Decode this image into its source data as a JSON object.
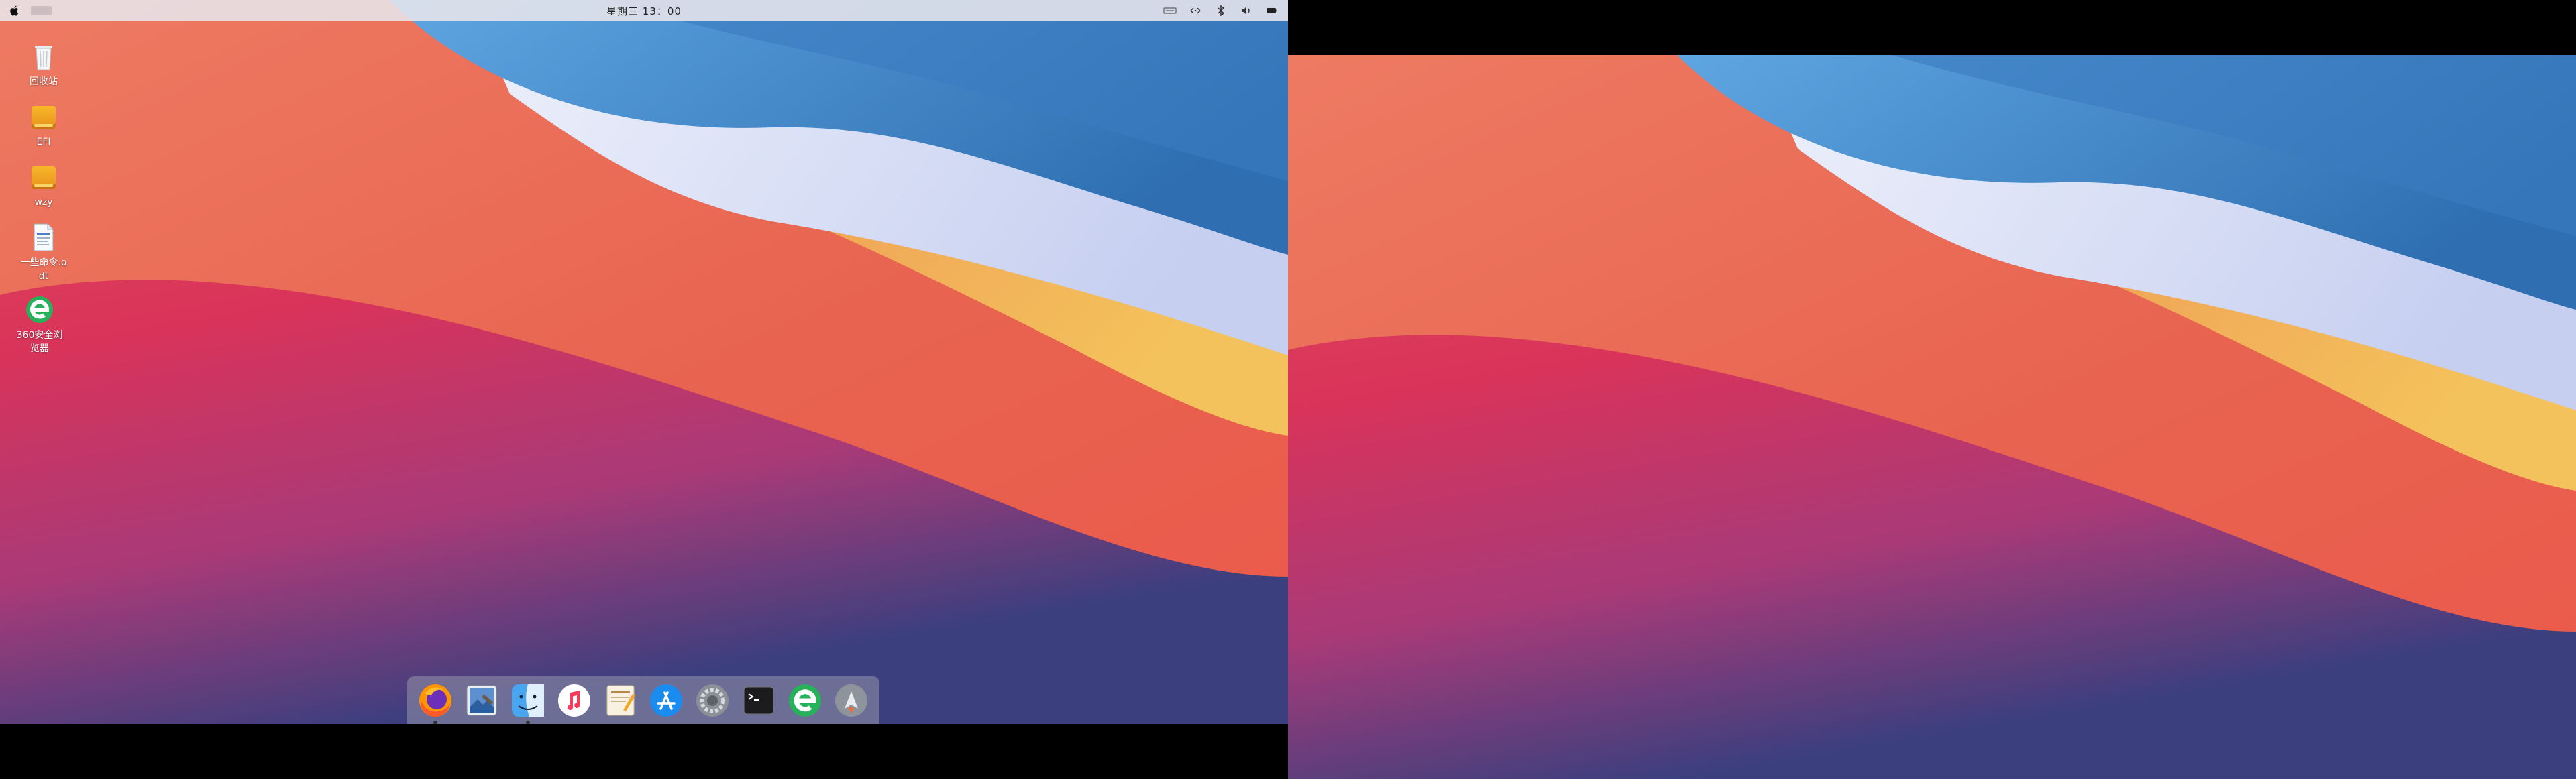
{
  "menubar": {
    "clock": "星期三 13：00",
    "tray_icons": [
      "input-method-icon",
      "network-icon",
      "bluetooth-icon",
      "volume-icon",
      "battery-icon"
    ]
  },
  "desktop": {
    "icons": [
      {
        "name": "trash",
        "label": "回收站",
        "icon": "trash-icon"
      },
      {
        "name": "efi",
        "label": "EFI",
        "icon": "drive-icon"
      },
      {
        "name": "wzy",
        "label": "wzy",
        "icon": "drive-icon"
      },
      {
        "name": "doc",
        "label": "一些命令.odt",
        "icon": "document-icon"
      },
      {
        "name": "browser360",
        "label": "360安全浏览器",
        "icon": "browser-360-icon"
      }
    ]
  },
  "dock": {
    "items": [
      {
        "name": "firefox",
        "icon": "firefox-icon"
      },
      {
        "name": "preview",
        "icon": "preview-icon"
      },
      {
        "name": "finder",
        "icon": "finder-icon"
      },
      {
        "name": "music",
        "icon": "music-icon"
      },
      {
        "name": "pages",
        "icon": "pages-icon"
      },
      {
        "name": "appstore",
        "icon": "app-store-icon"
      },
      {
        "name": "settings",
        "icon": "system-settings-icon"
      },
      {
        "name": "terminal",
        "icon": "terminal-icon"
      },
      {
        "name": "browser360",
        "icon": "browser-360-icon"
      },
      {
        "name": "launchpad",
        "icon": "launchpad-icon"
      }
    ]
  },
  "colors": {
    "wall_red": "#e8394f",
    "wall_orange": "#ec6a52",
    "wall_yellow": "#f2bd57",
    "wall_blue": "#3a7fc2",
    "wall_purple": "#4a3f86"
  }
}
